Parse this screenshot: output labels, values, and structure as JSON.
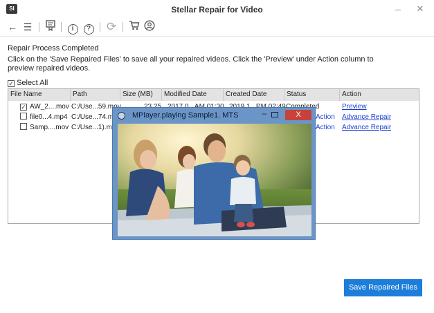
{
  "window": {
    "title": "Stellar Repair for Video",
    "logo_text": "SI",
    "minimize_glyph": "–",
    "close_glyph": "✕"
  },
  "toolbar": {
    "icons": [
      "back-arrow-icon",
      "menu-icon",
      "register-icon",
      "info-icon",
      "help-icon",
      "update-icon",
      "cart-icon",
      "account-icon"
    ],
    "back_glyph": "←",
    "menu_glyph": "☰",
    "register_glyph": "🖳",
    "info_glyph": "i",
    "help_glyph": "?",
    "update_glyph": "⟳",
    "cart_glyph": "🛒",
    "account_glyph": "☺"
  },
  "main": {
    "heading": "Repair Process Completed",
    "description": "Click on the 'Save Repaired Files' to save all your repaired videos. Click the 'Preview' under Action column to preview repaired videos.",
    "select_all_label": "Select All",
    "select_all_checked": true
  },
  "table": {
    "columns": [
      "File Name",
      "Path",
      "Size (MB)",
      "Modified Date",
      "Created Date",
      "Status",
      "Action"
    ],
    "rows": [
      {
        "checked": true,
        "name": "AW_2....mov",
        "path": "C:/Use...59.mov",
        "size": "23.25",
        "modified": "2017.0...AM 01:30",
        "created": "2019.1...PM 02:49",
        "status": "Completed",
        "action": "Preview"
      },
      {
        "checked": false,
        "name": "file0...4.mp4",
        "path": "C:/Use...74.m",
        "size": "",
        "modified": "",
        "created": "",
        "status": "Action",
        "action": "Advance Repair"
      },
      {
        "checked": false,
        "name": "Samp....mov",
        "path": "C:/Use...1).m",
        "size": "",
        "modified": "",
        "created": "",
        "status": "Action",
        "action": "Advance Repair"
      }
    ]
  },
  "player": {
    "title": "MPlayer.playing Sample1. MTS",
    "close_label": "X",
    "minimize_glyph": "–"
  },
  "footer": {
    "save_label": "Save Repaired Files"
  },
  "colors": {
    "accent": "#1c7ddb",
    "link": "#1a3fcf",
    "player_frame": "#6b95c6",
    "player_close": "#c8413a"
  }
}
